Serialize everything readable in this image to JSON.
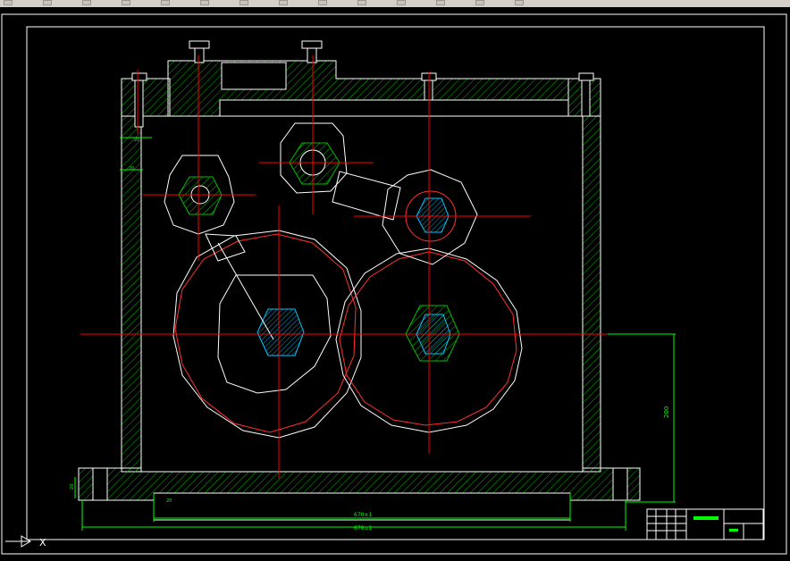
{
  "app": {
    "name": "CAD drawing viewport"
  },
  "toolbar": {
    "buttons": [
      {
        "name": "tb-button-1"
      },
      {
        "name": "tb-button-2"
      },
      {
        "name": "tb-button-3"
      },
      {
        "name": "tb-button-4"
      },
      {
        "name": "tb-button-5"
      },
      {
        "name": "tb-button-6"
      },
      {
        "name": "tb-button-7"
      },
      {
        "name": "tb-button-8"
      },
      {
        "name": "tb-button-9"
      },
      {
        "name": "tb-button-10"
      },
      {
        "name": "tb-button-11"
      },
      {
        "name": "tb-button-12"
      },
      {
        "name": "tb-button-13"
      },
      {
        "name": "tb-button-14"
      }
    ]
  },
  "drawing": {
    "dimensions": {
      "height_right": "200",
      "bottom_inner": "670±1",
      "bottom_outer": "670±1",
      "small_left": "20",
      "small_base": "20",
      "small_top1": "20",
      "small_top2": "20"
    },
    "colors": {
      "frame": "#ffffff",
      "centerline": "#ff0000",
      "hatch": "#00c000",
      "dimension": "#00ff00",
      "shaft": "#00c0ff",
      "title_mark": "#00ff00"
    }
  },
  "ucs": {
    "label": "X"
  }
}
